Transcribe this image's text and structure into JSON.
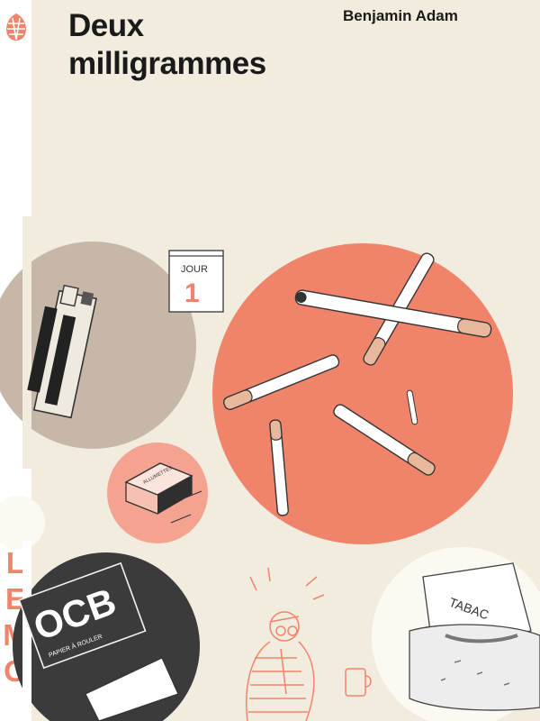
{
  "book": {
    "title_line1": "Deux",
    "title_line2": "milligrammes",
    "author": "Benjamin Adam"
  },
  "spine": {
    "publisher_letters": [
      "O",
      "L",
      "E",
      "M",
      "O"
    ]
  },
  "illustrations": {
    "calendar_word": "JOUR",
    "calendar_day": "1",
    "matchbox_text": "ALLUMETTES",
    "paper_brand": "OCB",
    "paper_subtitle": "PAPIER À ROULER",
    "tobacco_brand": "TABAC"
  },
  "colors": {
    "background": "#f1ecdd",
    "accent": "#f0846b",
    "dark_circle": "#3b3b3b",
    "beige_circle": "#c7b7a8"
  }
}
